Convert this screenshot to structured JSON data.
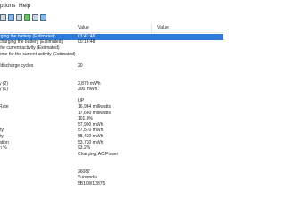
{
  "menu": {
    "items": [
      "ptions",
      "Help"
    ]
  },
  "table": {
    "headers": [
      "Value",
      "Value"
    ],
    "rows": [
      {
        "prop": "rging the battery (Estimated)",
        "value": "03:41:46",
        "selected": true
      },
      {
        "prop": "charging the battery (Estimated)",
        "value": "00:16:48",
        "selected": false
      },
      {
        "prop": "the current activity (Estimated)",
        "value": "",
        "selected": false
      },
      {
        "prop": "time for the current activity (Estimated)",
        "value": "",
        "selected": false
      },
      {
        "prop": "",
        "value": "",
        "selected": false
      },
      {
        "prop": "/discharge cycles",
        "value": "20",
        "selected": false
      },
      {
        "prop": "",
        "value": "",
        "selected": false
      },
      {
        "prop": "",
        "value": "",
        "selected": false
      },
      {
        "prop": "y (2)",
        "value": "2,870 mWh",
        "selected": false
      },
      {
        "prop": "y (1)",
        "value": "200 mWh",
        "selected": false
      },
      {
        "prop": "",
        "value": "",
        "selected": false
      },
      {
        "prop": "",
        "value": "LiP",
        "selected": false
      },
      {
        "prop": "Rate",
        "value": "16,964 milliwatts",
        "selected": false
      },
      {
        "prop": "",
        "value": "17,660 milliwatts",
        "selected": false
      },
      {
        "prop": "",
        "value": "101.0%",
        "selected": false
      },
      {
        "prop": "",
        "value": "57,990 mWh",
        "selected": false
      },
      {
        "prop": "ity",
        "value": "57,570 mWh",
        "selected": false
      },
      {
        "prop": "ity",
        "value": "58,430 mWh",
        "selected": false
      },
      {
        "prop": "ation",
        "value": "53,730 mWh",
        "selected": false
      },
      {
        "prop": "n %",
        "value": "93.2%",
        "selected": false
      },
      {
        "prop": "",
        "value": "Charging, AC Power",
        "selected": false
      },
      {
        "prop": "",
        "value": "",
        "selected": false
      },
      {
        "prop": "",
        "value": "",
        "selected": false
      },
      {
        "prop": "",
        "value": "26087",
        "selected": false
      },
      {
        "prop": "",
        "value": "Sunwoda",
        "selected": false
      },
      {
        "prop": "",
        "value": "5B10W13875",
        "selected": false
      }
    ]
  }
}
